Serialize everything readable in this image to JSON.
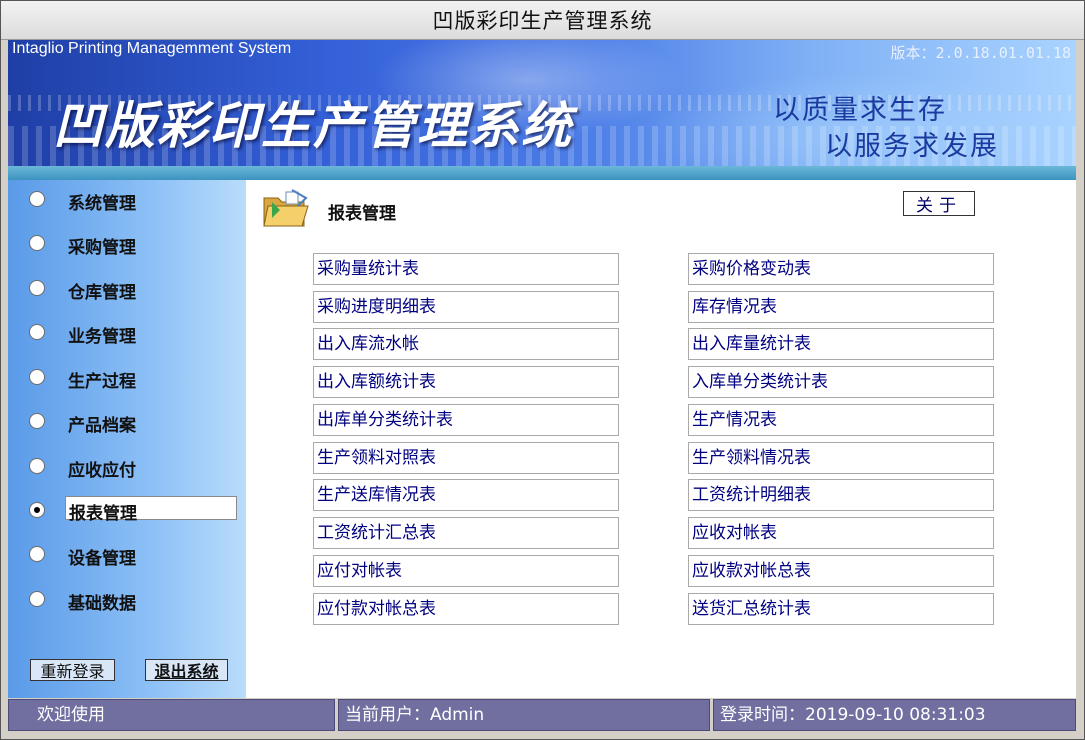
{
  "window": {
    "title": "凹版彩印生产管理系统"
  },
  "banner": {
    "english_title": "Intaglio Printing Managemment System",
    "version": "版本：2.0.18.01.01.18",
    "title": "凹版彩印生产管理系统",
    "slogan_line1": "以质量求生存",
    "slogan_line2": "以服务求发展"
  },
  "sidebar": {
    "items": [
      {
        "label": "系统管理",
        "checked": false
      },
      {
        "label": "采购管理",
        "checked": false
      },
      {
        "label": "仓库管理",
        "checked": false
      },
      {
        "label": "业务管理",
        "checked": false
      },
      {
        "label": "生产过程",
        "checked": false
      },
      {
        "label": "产品档案",
        "checked": false
      },
      {
        "label": "应收应付",
        "checked": false
      },
      {
        "label": "报表管理",
        "checked": true
      },
      {
        "label": "设备管理",
        "checked": false
      },
      {
        "label": "基础数据",
        "checked": false
      }
    ],
    "relogin_label": "重新登录",
    "exit_label": "退出系统"
  },
  "main": {
    "section_title": "报表管理",
    "about_label": "关于",
    "reports_left": [
      "采购量统计表",
      "采购进度明细表",
      "出入库流水帐",
      "出入库额统计表",
      "出库单分类统计表",
      "生产领料对照表",
      "生产送库情况表",
      "工资统计汇总表",
      "应付对帐表",
      "应付款对帐总表"
    ],
    "reports_right": [
      "采购价格变动表",
      "库存情况表",
      "出入库量统计表",
      "入库单分类统计表",
      "生产情况表",
      "生产领料情况表",
      "工资统计明细表",
      "应收对帐表",
      "应收款对帐总表",
      "送货汇总统计表"
    ]
  },
  "statusbar": {
    "welcome": "欢迎使用",
    "current_user": "当前用户：Admin",
    "login_time": "登录时间：2019-09-10 08:31:03"
  },
  "colors": {
    "sidebar_blue": "#5a9ae8",
    "status_purple": "#716fa0",
    "report_text": "#000080"
  }
}
